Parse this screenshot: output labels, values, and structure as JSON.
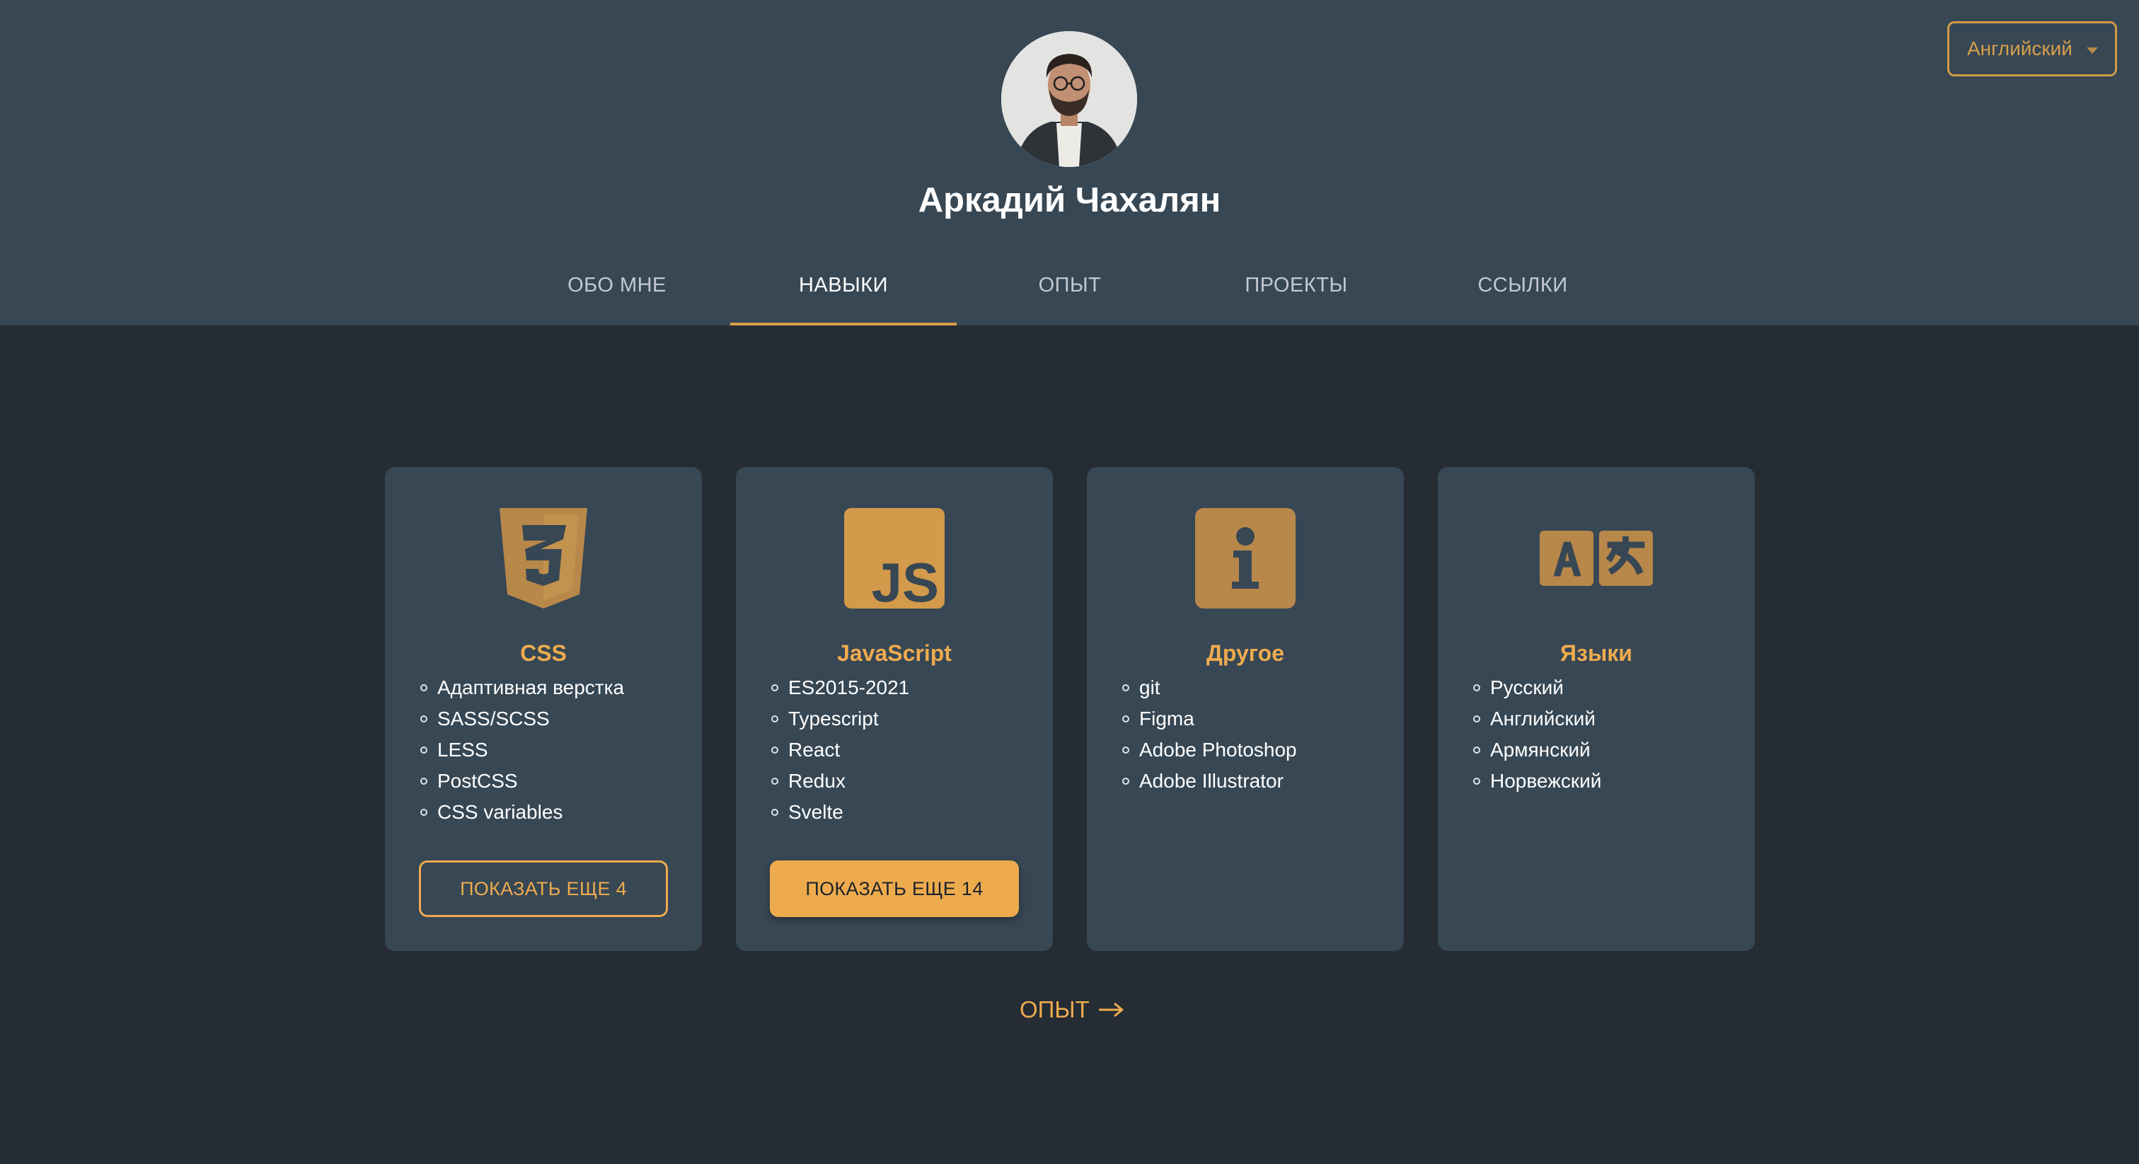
{
  "language_select": {
    "value": "Английский"
  },
  "profile": {
    "name": "Аркадий Чахалян"
  },
  "tabs": [
    {
      "label": "ОБО МНЕ"
    },
    {
      "label": "НАВЫКИ"
    },
    {
      "label": "ОПЫТ"
    },
    {
      "label": "ПРОЕКТЫ"
    },
    {
      "label": "ССЫЛКИ"
    }
  ],
  "active_tab": "НАВЫКИ",
  "cards": [
    {
      "icon": "css3-icon",
      "title": "CSS",
      "items": [
        "Адаптивная верстка",
        "SASS/SCSS",
        "LESS",
        "PostCSS",
        "CSS variables"
      ],
      "button": "ПОКАЗАТЬ ЕЩЕ 4"
    },
    {
      "icon": "javascript-icon",
      "title": "JavaScript",
      "items": [
        "ES2015-2021",
        "Typescript",
        "React",
        "Redux",
        "Svelte"
      ],
      "button": "ПОКАЗАТЬ ЕЩЕ 14"
    },
    {
      "icon": "info-icon",
      "title": "Другое",
      "items": [
        "git",
        "Figma",
        "Adobe Photoshop",
        "Adobe Illustrator"
      ]
    },
    {
      "icon": "translate-icon",
      "title": "Языки",
      "items": [
        "Русский",
        "Английский",
        "Армянский",
        "Норвежский"
      ]
    }
  ],
  "next_link": {
    "label": "ОПЫТ"
  },
  "colors": {
    "header_bg": "#374754",
    "page_bg": "#252c33",
    "card_bg": "#374754",
    "accent": "#eeab4e",
    "icon_gold": "#b8874a"
  }
}
